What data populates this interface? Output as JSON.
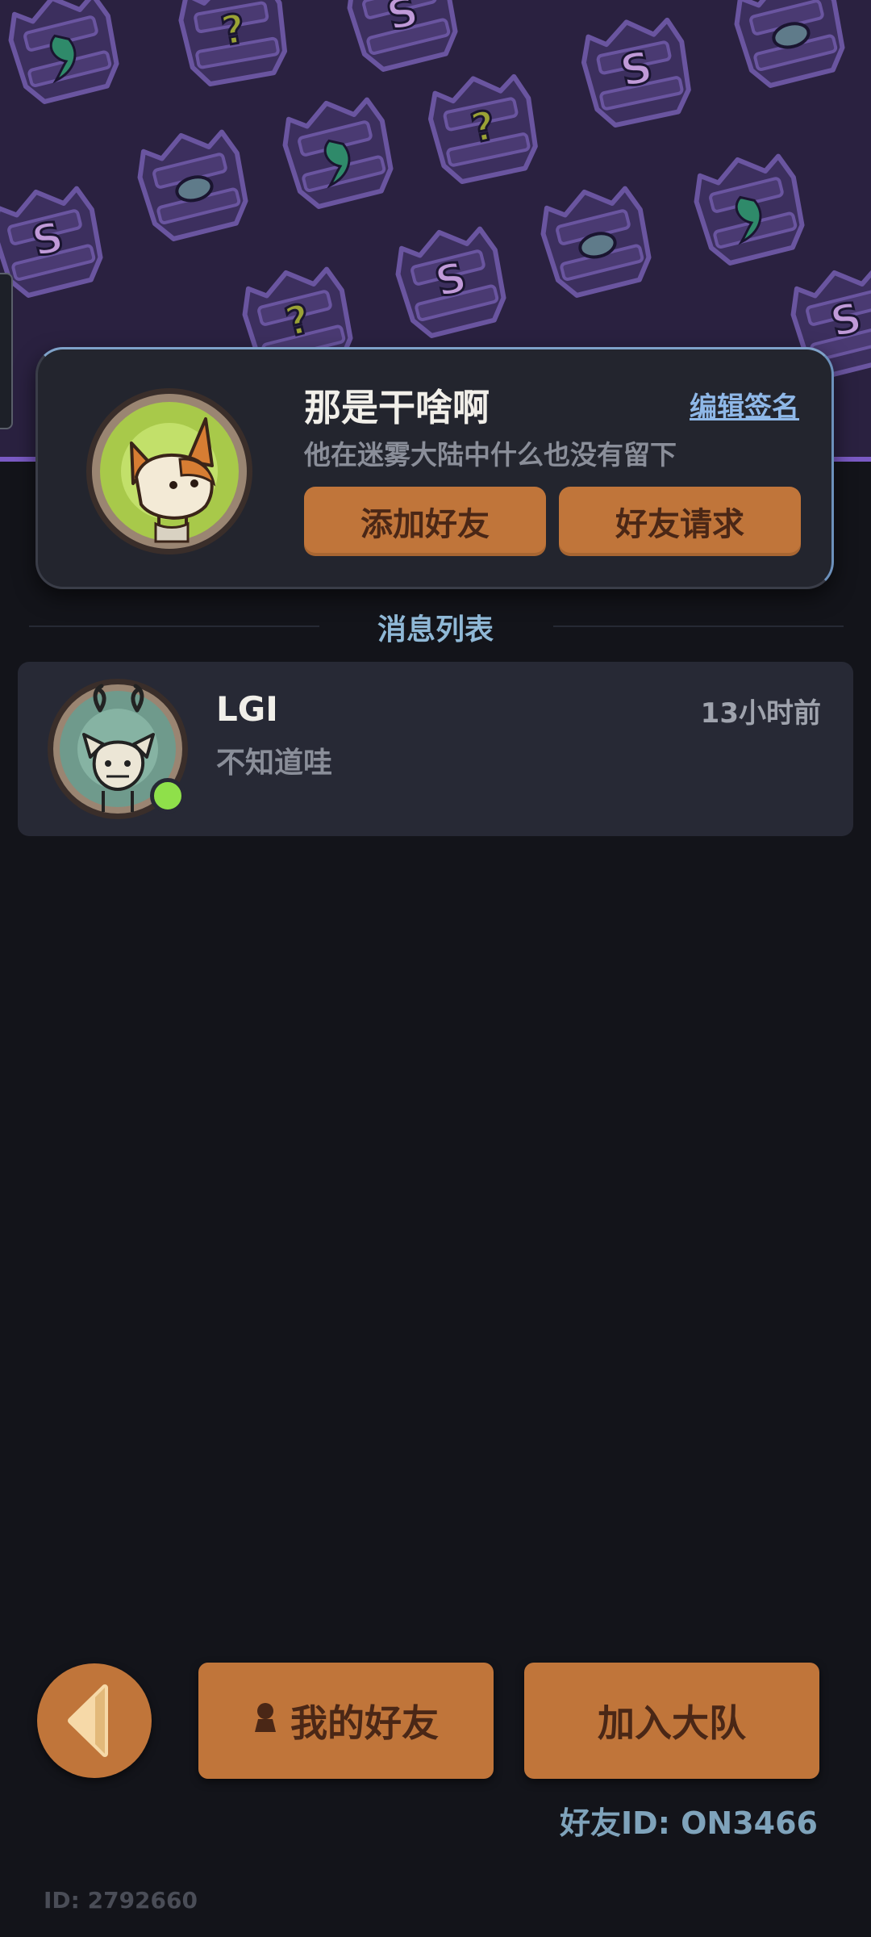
{
  "profile": {
    "name": "那是干啥啊",
    "edit_sign_label": "编辑签名",
    "signature": "他在迷雾大陆中什么也没有留下",
    "add_friend_label": "添加好友",
    "friend_requests_label": "好友请求"
  },
  "messages": {
    "title": "消息列表",
    "items": [
      {
        "name": "LGI",
        "preview": "不知道哇",
        "time": "13小时前",
        "online": true
      }
    ]
  },
  "bottom": {
    "my_friends_label": "我的好友",
    "join_team_label": "加入大队",
    "friend_id": "好友ID: ON3466",
    "user_id": "ID: 2792660"
  },
  "colors": {
    "accent": "#c0753a",
    "accent_text": "#4a2716",
    "background": "#13141a",
    "banner": "#2a2140",
    "link": "#8fb8e8",
    "online": "#8fe04a"
  },
  "icons": [
    "back-arrow-icon",
    "person-icon",
    "fox-avatar",
    "deer-cat-avatar"
  ]
}
